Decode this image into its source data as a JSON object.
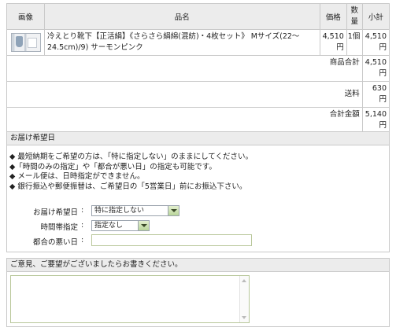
{
  "cart": {
    "headers": {
      "image": "画像",
      "name": "品名",
      "price": "価格",
      "qty": "数量",
      "subtotal": "小計"
    },
    "item": {
      "image_alt": "product-thumbnail",
      "name": "冷えとり靴下【正活絹】《さらさら絹綿(混紡)・4枚セット》 Mサイズ(22〜24.5cm)/9) サーモンピンク",
      "price": "4,510円",
      "qty": "1個",
      "subtotal": "4,510円"
    },
    "product_total_label": "商品合計",
    "product_total_value": "4,510円",
    "shipping_label": "送料",
    "shipping_value": "630円",
    "grand_total_label": "合計金額",
    "grand_total_value": "5,140円"
  },
  "delivery": {
    "title": "お届け希望日",
    "notes": [
      "◆ 最短納期をご希望の方は、「特に指定しない」のままにしてください。",
      "◆「時間のみの指定」や「都合が悪い日」の指定も可能です。",
      "◆ メール便は、日時指定ができません。",
      "◆ 銀行振込や郵便振替は、ご希望日の「5営業日」前にお振込下さい。"
    ],
    "date_label": "お届け希望日",
    "date_value": "特に指定しない",
    "time_label": "時間帯指定",
    "time_value": "指定なし",
    "bad_day_label": "都合の悪い日",
    "bad_day_value": "",
    "colon": ":"
  },
  "comments": {
    "title": "ご意見、ご要望がございましたらお書きください。",
    "value": ""
  }
}
